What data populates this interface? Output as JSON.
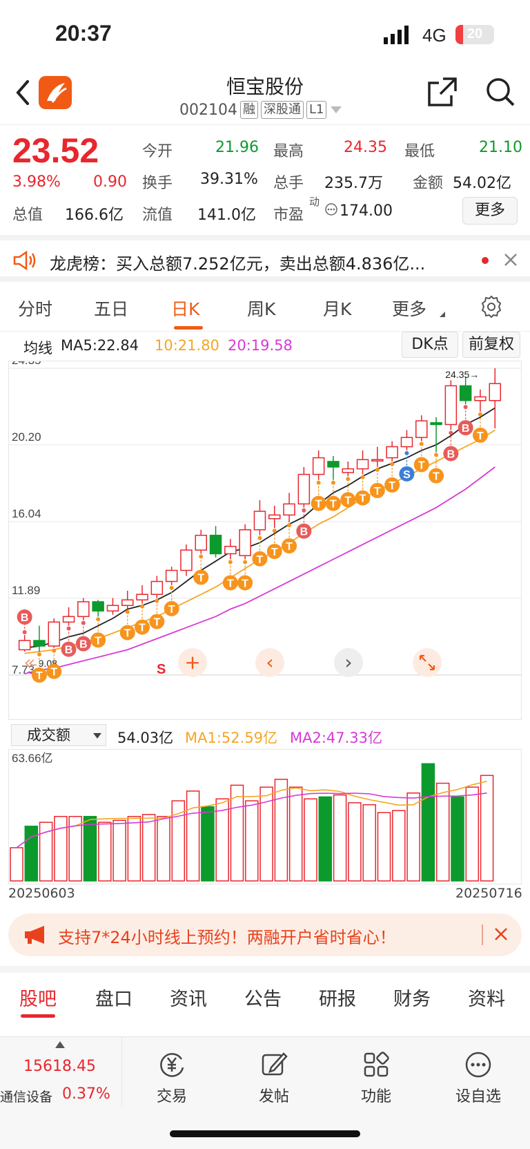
{
  "status": {
    "time": "20:37",
    "network": "4G",
    "battery": "20",
    "battery_level": 0.2
  },
  "header": {
    "title": "恒宝股份",
    "code": "002104",
    "tags": [
      "融",
      "深股通",
      "L1"
    ]
  },
  "quote": {
    "price": "23.52",
    "change_pct": "3.98%",
    "change": "0.90",
    "open_label": "今开",
    "open": "21.96",
    "high_label": "最高",
    "high": "24.35",
    "low_label": "最低",
    "low": "21.10",
    "turnover_label": "换手",
    "turnover": "39.31%",
    "volume_label": "总手",
    "volume": "235.7万",
    "amount_label": "金额",
    "amount": "54.02亿",
    "mcap_label": "总值",
    "mcap": "166.6亿",
    "float_label": "流值",
    "float": "141.0亿",
    "pe_label": "市盈",
    "pe_sup": "动",
    "pe": "174.00",
    "more": "更多"
  },
  "notice": {
    "text": "龙虎榜：买入总额7.252亿元，卖出总额4.836亿..."
  },
  "tabs": [
    "分时",
    "五日",
    "日K",
    "周K",
    "月K",
    "更多"
  ],
  "ma": {
    "label": "均线",
    "ma5": "MA5:22.84",
    "ma10": "10:21.80",
    "ma20": "20:19.58",
    "btn_dk": "DK点",
    "btn_adj": "前复权"
  },
  "chart_data": {
    "type": "candlestick",
    "y_ticks": [
      "24.35",
      "20.20",
      "16.04",
      "11.89",
      "7.73"
    ],
    "ylim": [
      7.73,
      24.35
    ],
    "high_annotation": "24.35",
    "low_annotation": "9.08",
    "candles": [
      {
        "o": 9.1,
        "c": 9.6,
        "h": 9.9,
        "l": 9.0
      },
      {
        "o": 9.6,
        "c": 9.3,
        "h": 10.4,
        "l": 9.0
      },
      {
        "o": 9.3,
        "c": 10.6,
        "h": 10.8,
        "l": 9.2
      },
      {
        "o": 10.6,
        "c": 10.9,
        "h": 11.4,
        "l": 10.4
      },
      {
        "o": 10.9,
        "c": 11.7,
        "h": 11.9,
        "l": 10.7
      },
      {
        "o": 11.7,
        "c": 11.2,
        "h": 11.8,
        "l": 10.9
      },
      {
        "o": 11.2,
        "c": 11.5,
        "h": 11.9,
        "l": 11.0
      },
      {
        "o": 11.5,
        "c": 11.8,
        "h": 12.3,
        "l": 11.3
      },
      {
        "o": 11.8,
        "c": 12.1,
        "h": 12.6,
        "l": 11.6
      },
      {
        "o": 12.1,
        "c": 12.8,
        "h": 13.1,
        "l": 11.9
      },
      {
        "o": 12.8,
        "c": 13.4,
        "h": 13.6,
        "l": 12.6
      },
      {
        "o": 13.4,
        "c": 14.5,
        "h": 14.8,
        "l": 13.1
      },
      {
        "o": 14.5,
        "c": 15.3,
        "h": 15.6,
        "l": 14.3
      },
      {
        "o": 15.3,
        "c": 14.3,
        "h": 15.8,
        "l": 14.1
      },
      {
        "o": 14.3,
        "c": 14.7,
        "h": 15.1,
        "l": 14.0
      },
      {
        "o": 14.2,
        "c": 15.6,
        "h": 15.9,
        "l": 14.0
      },
      {
        "o": 15.6,
        "c": 16.6,
        "h": 17.2,
        "l": 15.3
      },
      {
        "o": 16.2,
        "c": 16.4,
        "h": 16.9,
        "l": 15.7
      },
      {
        "o": 16.4,
        "c": 17.0,
        "h": 17.6,
        "l": 16.0
      },
      {
        "o": 17.0,
        "c": 18.6,
        "h": 19.0,
        "l": 16.8
      },
      {
        "o": 18.6,
        "c": 19.5,
        "h": 19.9,
        "l": 18.3
      },
      {
        "o": 19.3,
        "c": 19.0,
        "h": 19.6,
        "l": 18.3
      },
      {
        "o": 18.7,
        "c": 18.9,
        "h": 19.3,
        "l": 18.5
      },
      {
        "o": 18.9,
        "c": 19.4,
        "h": 19.9,
        "l": 18.6
      },
      {
        "o": 19.4,
        "c": 19.4,
        "h": 20.1,
        "l": 19.0
      },
      {
        "o": 19.5,
        "c": 20.1,
        "h": 20.4,
        "l": 19.3
      },
      {
        "o": 20.1,
        "c": 20.6,
        "h": 21.0,
        "l": 19.9
      },
      {
        "o": 20.6,
        "c": 21.5,
        "h": 21.8,
        "l": 20.4
      },
      {
        "o": 21.4,
        "c": 21.3,
        "h": 21.7,
        "l": 19.8
      },
      {
        "o": 21.3,
        "c": 23.4,
        "h": 23.7,
        "l": 21.0
      },
      {
        "o": 23.4,
        "c": 22.6,
        "h": 23.9,
        "l": 22.4
      },
      {
        "o": 22.6,
        "c": 22.8,
        "h": 23.2,
        "l": 22.0
      },
      {
        "o": 22.6,
        "c": 23.52,
        "h": 24.35,
        "l": 21.1
      }
    ],
    "ma5": [
      9.2,
      9.3,
      9.5,
      9.8,
      10.0,
      10.4,
      10.8,
      11.3,
      11.5,
      11.8,
      12.2,
      12.8,
      13.4,
      13.9,
      14.4,
      14.6,
      14.9,
      15.4,
      15.9,
      16.3,
      17.0,
      17.6,
      18.0,
      18.5,
      18.9,
      19.2,
      19.5,
      19.9,
      20.2,
      20.7,
      21.3,
      21.7,
      22.2
    ],
    "ma10": [
      8.9,
      9.0,
      9.1,
      9.3,
      9.5,
      9.7,
      10.0,
      10.3,
      10.6,
      10.9,
      11.3,
      11.7,
      12.1,
      12.5,
      13.0,
      13.5,
      14.0,
      14.4,
      14.9,
      15.4,
      15.9,
      16.3,
      16.8,
      17.3,
      17.7,
      18.1,
      18.5,
      18.9,
      19.3,
      19.7,
      20.1,
      20.5,
      21.0
    ],
    "ma20": [
      7.8,
      8.0,
      8.1,
      8.3,
      8.5,
      8.7,
      8.9,
      9.1,
      9.4,
      9.7,
      10.0,
      10.3,
      10.6,
      10.9,
      11.3,
      11.6,
      12.0,
      12.4,
      12.8,
      13.2,
      13.6,
      14.0,
      14.4,
      14.8,
      15.2,
      15.6,
      16.0,
      16.4,
      16.8,
      17.3,
      17.8,
      18.4,
      19.0
    ],
    "signals": [
      "B",
      "T",
      "T",
      "B",
      "B",
      "T",
      "",
      "T",
      "T",
      "T",
      "T",
      "",
      "T",
      "",
      "T",
      "T",
      "T",
      "T",
      "T",
      "B",
      "T",
      "T",
      "T",
      "T",
      "T",
      "T",
      "S",
      "T",
      "T",
      "B",
      "B",
      "T",
      ""
    ]
  },
  "chart_controls": {
    "s_mark": "S",
    "plus": "+",
    "prev": "‹",
    "next": "›"
  },
  "volume": {
    "select": "成交额",
    "value": "54.03亿",
    "ma1": "MA1:52.59亿",
    "ma2": "MA2:47.33亿",
    "ymax_label": "63.66亿",
    "ymax": 63.66,
    "start_date": "20250603",
    "end_date": "20250716",
    "values": [
      17,
      28,
      30,
      33,
      33,
      33,
      30,
      31,
      33,
      34,
      33,
      41,
      46,
      38,
      42,
      49,
      41,
      48,
      52,
      48,
      42,
      43,
      44,
      40,
      39,
      35,
      36,
      45,
      60,
      50,
      43,
      48,
      54
    ]
  },
  "promo": {
    "text": "支持7*24小时线上预约！两融开户省时省心！"
  },
  "bottom_tabs": [
    "股吧",
    "盘口",
    "资讯",
    "公告",
    "研报",
    "财务",
    "资料"
  ],
  "footer": {
    "index": "15618.45",
    "sector": "通信设备",
    "sector_pct": "0.37%",
    "items": [
      "交易",
      "发帖",
      "功能",
      "设自选"
    ]
  }
}
